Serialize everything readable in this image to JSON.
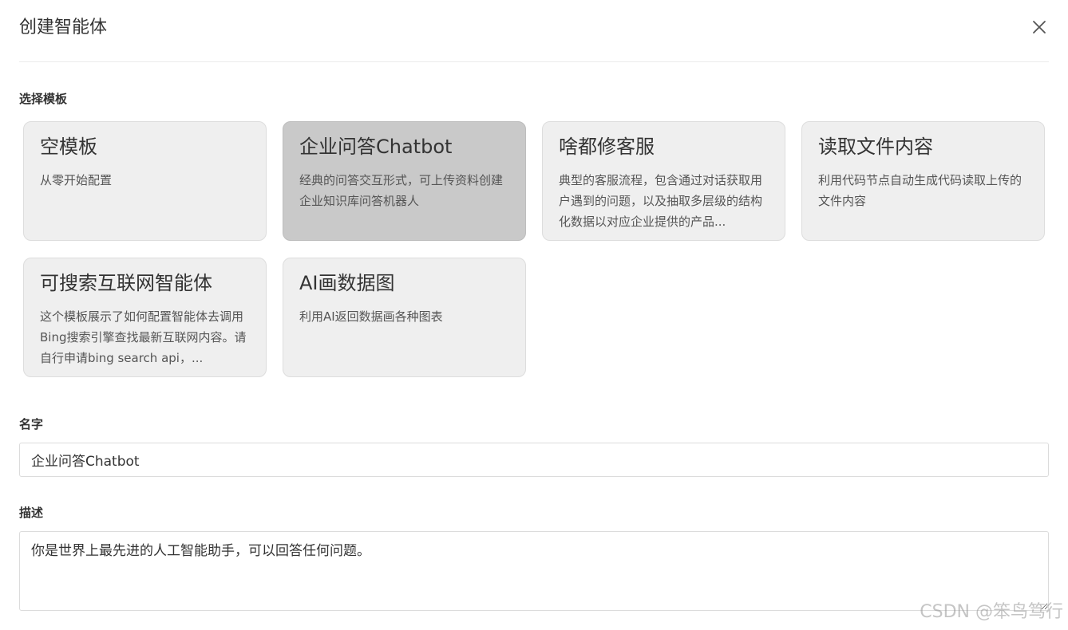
{
  "dialog": {
    "title": "创建智能体",
    "close_icon": "close-icon"
  },
  "templates": {
    "label": "选择模板",
    "items": [
      {
        "title": "空模板",
        "desc": "从零开始配置",
        "selected": false
      },
      {
        "title": "企业问答Chatbot",
        "desc": "经典的问答交互形式，可上传资料创建企业知识库问答机器人",
        "selected": true
      },
      {
        "title": "啥都修客服",
        "desc": "典型的客服流程，包含通过对话获取用户遇到的问题，以及抽取多层级的结构化数据以对应企业提供的产品...",
        "selected": false
      },
      {
        "title": "读取文件内容",
        "desc": "利用代码节点自动生成代码读取上传的文件内容",
        "selected": false
      },
      {
        "title": "可搜索互联网智能体",
        "desc": "这个模板展示了如何配置智能体去调用Bing搜索引擎查找最新互联网内容。请自行申请bing search api，...",
        "selected": false
      },
      {
        "title": "AI画数据图",
        "desc": "利用AI返回数据画各种图表",
        "selected": false
      }
    ]
  },
  "form": {
    "name_label": "名字",
    "name_value": "企业问答Chatbot",
    "desc_label": "描述",
    "desc_value": "你是世界上最先进的人工智能助手，可以回答任何问题。"
  },
  "watermark": "CSDN @笨鸟笃行"
}
